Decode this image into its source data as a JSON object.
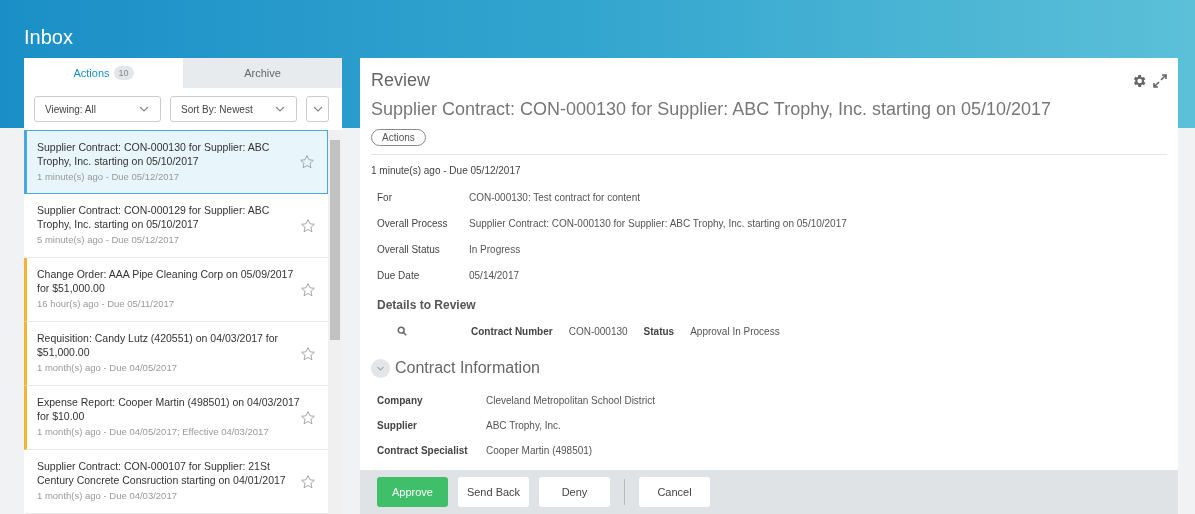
{
  "header": {
    "title": "Inbox"
  },
  "tabs": [
    {
      "label": "Actions",
      "count": "10",
      "selected": true
    },
    {
      "label": "Archive",
      "selected": false
    }
  ],
  "filters": {
    "viewing": "Viewing: All",
    "sort": "Sort By: Newest"
  },
  "items": [
    {
      "title": "Supplier Contract: CON-000130 for Supplier: ABC Trophy, Inc. starting on 05/10/2017",
      "meta": "1 minute(s) ago - Due 05/12/2017",
      "selected": true,
      "flagged": false
    },
    {
      "title": "Supplier Contract: CON-000129 for Supplier: ABC Trophy, Inc. starting on 05/10/2017",
      "meta": "5 minute(s) ago - Due 05/12/2017",
      "selected": false,
      "flagged": false
    },
    {
      "title": "Change Order: AAA Pipe Cleaning Corp on 05/09/2017 for $51,000.00",
      "meta": "16 hour(s) ago - Due 05/11/2017",
      "selected": false,
      "flagged": true
    },
    {
      "title": "Requisition: Candy Lutz (420551) on 04/03/2017 for $51,000.00",
      "meta": "1 month(s) ago - Due 04/05/2017",
      "selected": false,
      "flagged": true
    },
    {
      "title": "Expense Report: Cooper Martin (498501) on 04/03/2017 for $10.00",
      "meta": "1 month(s) ago - Due 04/05/2017; Effective 04/03/2017",
      "selected": false,
      "flagged": true
    },
    {
      "title": "Supplier Contract: CON-000107 for Supplier: 21St Century Concrete Consruction starting on 04/01/2017",
      "meta": "1 month(s) ago - Due 04/03/2017",
      "selected": false,
      "flagged": false
    }
  ],
  "review": {
    "heading": "Review",
    "title": "Supplier Contract: CON-000130 for Supplier: ABC Trophy, Inc. starting on 05/10/2017",
    "actions_button": "Actions",
    "meta": "1 minute(s) ago - Due 05/12/2017",
    "fields": [
      {
        "label": "For",
        "value": "CON-000130: Test contract for content"
      },
      {
        "label": "Overall Process",
        "value": "Supplier Contract: CON-000130 for Supplier: ABC Trophy, Inc. starting on 05/10/2017"
      },
      {
        "label": "Overall Status",
        "value": "In Progress"
      },
      {
        "label": "Due Date",
        "value": "05/14/2017"
      }
    ],
    "details_heading": "Details to Review",
    "details": [
      {
        "label": "Contract Number",
        "value": "CON-000130"
      },
      {
        "label": "Status",
        "value": "Approval In Process"
      }
    ],
    "section_title": "Contract Information",
    "section_expanded": true,
    "contract_fields": [
      {
        "label": "Company",
        "value": "Cleveland Metropolitan School District"
      },
      {
        "label": "Supplier",
        "value": "ABC Trophy, Inc."
      },
      {
        "label": "Contract Specialist",
        "value": "Cooper Martin (498501)"
      }
    ]
  },
  "buttons": [
    {
      "label": "Approve",
      "kind": "primary"
    },
    {
      "label": "Send Back",
      "kind": "secondary"
    },
    {
      "label": "Deny",
      "kind": "secondary"
    },
    {
      "label": "Cancel",
      "kind": "cancel"
    }
  ]
}
